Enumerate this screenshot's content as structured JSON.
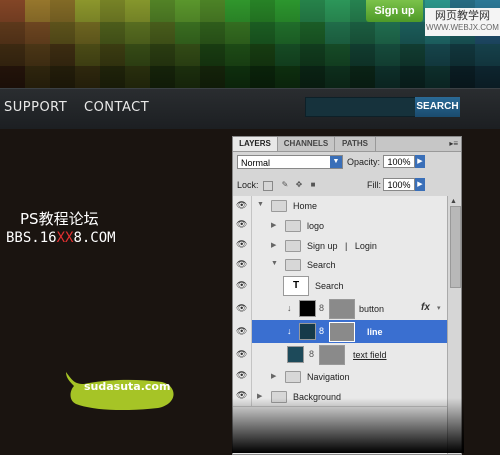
{
  "header": {
    "signup_label": "Sign up"
  },
  "watermark": {
    "line1": "网页教学网",
    "line2": "WWW.WEBJX.COM"
  },
  "nav": {
    "support": "SUPPORT",
    "contact": "CONTACT",
    "search_label": "SEARCH"
  },
  "overlay": {
    "ps_text": "PS教程论坛",
    "bbs_prefix": "BBS.16",
    "bbs_red": "XX",
    "bbs_suffix": "8.COM"
  },
  "logo": {
    "text": "sudasuta.com"
  },
  "layers_panel": {
    "tabs": [
      "LAYERS",
      "CHANNELS",
      "PATHS"
    ],
    "blend_mode": "Normal",
    "opacity_label": "Opacity:",
    "opacity_value": "100%",
    "lock_label": "Lock:",
    "fill_label": "Fill:",
    "fill_value": "100%",
    "layers": [
      {
        "name": "Home",
        "kind": "group",
        "expanded": true
      },
      {
        "name": "logo",
        "kind": "group",
        "expanded": false
      },
      {
        "name": "Sign up   |   Login",
        "kind": "group",
        "expanded": false
      },
      {
        "name": "Search",
        "kind": "group",
        "expanded": true
      },
      {
        "name": "Search",
        "kind": "text",
        "thumb": "T"
      },
      {
        "name": "button",
        "kind": "layer",
        "fx": "fx"
      },
      {
        "name": "line",
        "kind": "layer",
        "selected": true
      },
      {
        "name": "text field",
        "kind": "layer"
      },
      {
        "name": "Navigation",
        "kind": "group",
        "expanded": false
      },
      {
        "name": "Background",
        "kind": "group",
        "expanded": false
      }
    ]
  },
  "colors": {
    "selected_row": "#3a6fd0",
    "signup_green": "#5aa832",
    "search_blue": "#2a6a96",
    "blob_green": "#a6c426"
  }
}
